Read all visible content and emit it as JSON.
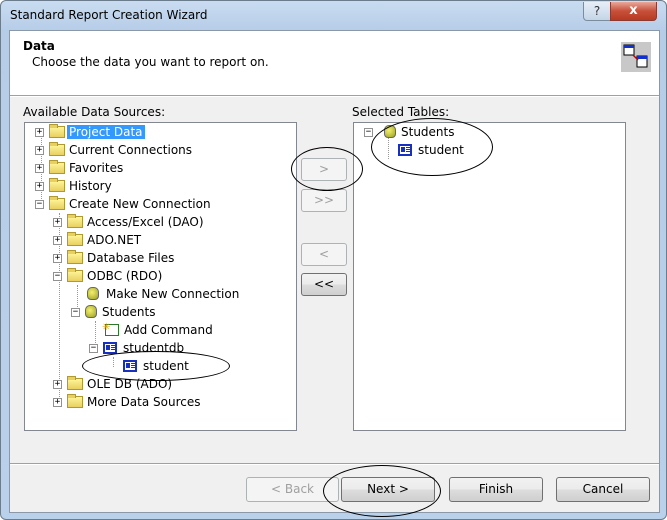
{
  "window": {
    "title": "Standard Report Creation Wizard",
    "help_label": "?",
    "close_label": "x"
  },
  "header": {
    "title": "Data",
    "subtitle": "Choose the data you want to report on.",
    "icon": "table-link-icon"
  },
  "available": {
    "label": "Available Data Sources:",
    "items": [
      {
        "label": "Project Data",
        "icon": "folder-icon",
        "expander": "+",
        "selected": true
      },
      {
        "label": "Current Connections",
        "icon": "folder-icon",
        "expander": "+"
      },
      {
        "label": "Favorites",
        "icon": "folder-icon",
        "expander": "+"
      },
      {
        "label": "History",
        "icon": "folder-icon",
        "expander": "+"
      },
      {
        "label": "Create New Connection",
        "icon": "folder-icon",
        "expander": "-"
      },
      {
        "label": "Access/Excel (DAO)",
        "icon": "folder-icon",
        "expander": "+"
      },
      {
        "label": "ADO.NET",
        "icon": "folder-icon",
        "expander": "+"
      },
      {
        "label": "Database Files",
        "icon": "folder-icon",
        "expander": "+"
      },
      {
        "label": "ODBC (RDO)",
        "icon": "folder-icon",
        "expander": "-"
      },
      {
        "label": "Make New Connection",
        "icon": "new-connection-icon"
      },
      {
        "label": "Students",
        "icon": "database-icon",
        "expander": "-"
      },
      {
        "label": "Add Command",
        "icon": "add-command-icon"
      },
      {
        "label": "studentdb",
        "icon": "table-icon",
        "expander": "-"
      },
      {
        "label": "student",
        "icon": "table-icon"
      },
      {
        "label": "OLE DB (ADO)",
        "icon": "folder-icon",
        "expander": "+"
      },
      {
        "label": "More Data Sources",
        "icon": "folder-icon",
        "expander": "+"
      }
    ]
  },
  "transfer": {
    "add_one": ">",
    "add_all": ">>",
    "remove_one": "<",
    "remove_all": "<<"
  },
  "selected": {
    "label": "Selected Tables:",
    "items": [
      {
        "label": "Students",
        "icon": "database-icon",
        "expander": "-"
      },
      {
        "label": "student",
        "icon": "table-icon"
      }
    ]
  },
  "footer": {
    "back": "< Back",
    "next": "Next >",
    "finish": "Finish",
    "cancel": "Cancel"
  }
}
